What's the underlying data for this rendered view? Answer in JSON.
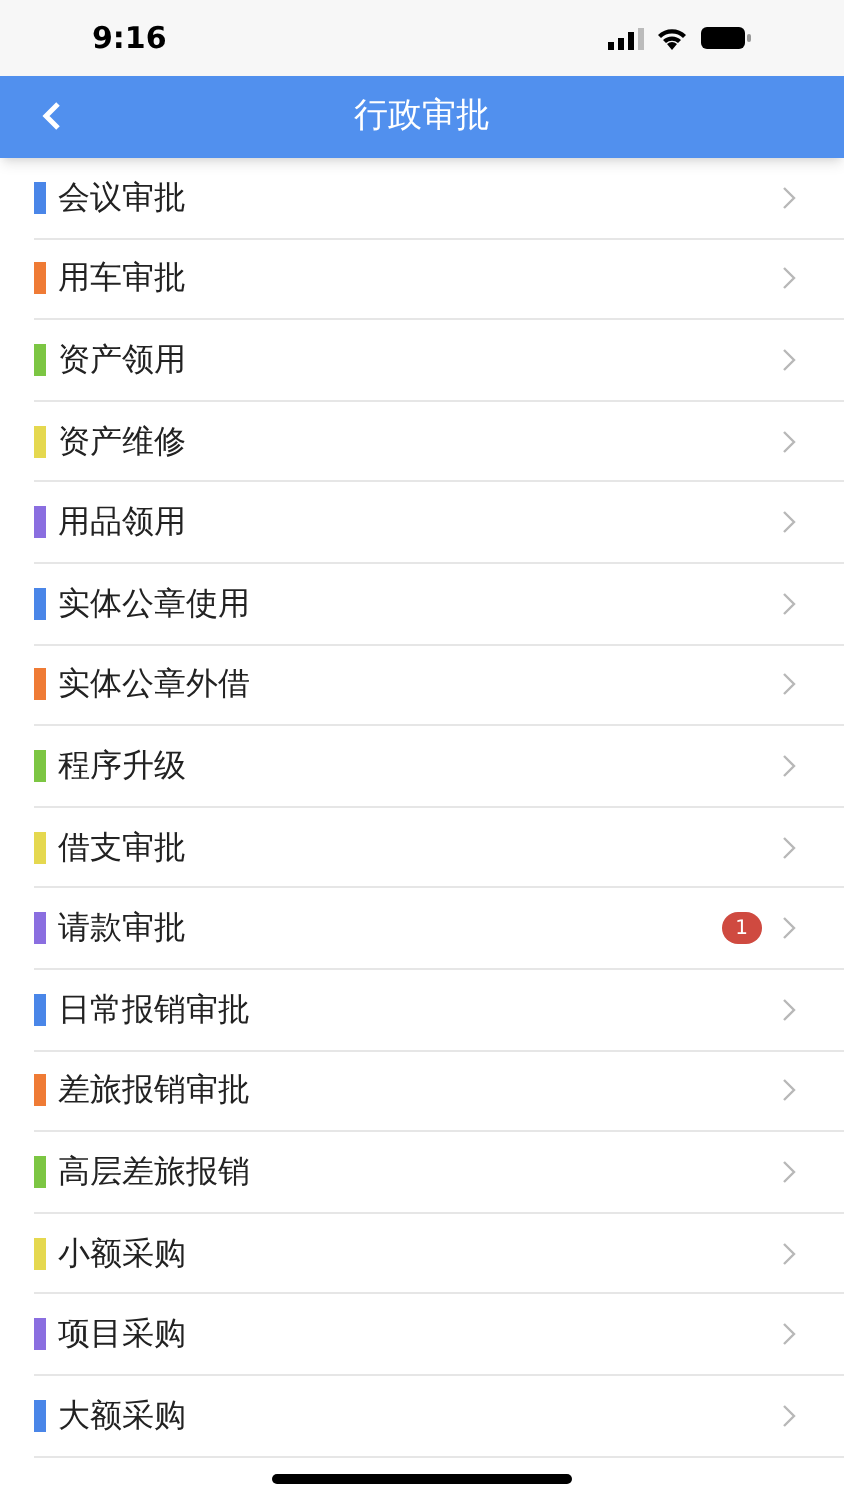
{
  "status_bar": {
    "time": "9:16"
  },
  "nav": {
    "title": "行政审批"
  },
  "items": [
    {
      "label": "会议审批",
      "color": "#4a86e8"
    },
    {
      "label": "用车审批",
      "color": "#ef7b35"
    },
    {
      "label": "资产领用",
      "color": "#7cc643"
    },
    {
      "label": "资产维修",
      "color": "#e5d84f"
    },
    {
      "label": "用品领用",
      "color": "#8a6ee0"
    },
    {
      "label": "实体公章使用",
      "color": "#4a86e8"
    },
    {
      "label": "实体公章外借",
      "color": "#ef7b35"
    },
    {
      "label": "程序升级",
      "color": "#7cc643"
    },
    {
      "label": "借支审批",
      "color": "#e5d84f"
    },
    {
      "label": "请款审批",
      "color": "#8a6ee0",
      "badge": "1"
    },
    {
      "label": "日常报销审批",
      "color": "#4a86e8"
    },
    {
      "label": "差旅报销审批",
      "color": "#ef7b35"
    },
    {
      "label": "高层差旅报销",
      "color": "#7cc643"
    },
    {
      "label": "小额采购",
      "color": "#e5d84f"
    },
    {
      "label": "项目采购",
      "color": "#8a6ee0"
    },
    {
      "label": "大额采购",
      "color": "#4a86e8"
    }
  ]
}
